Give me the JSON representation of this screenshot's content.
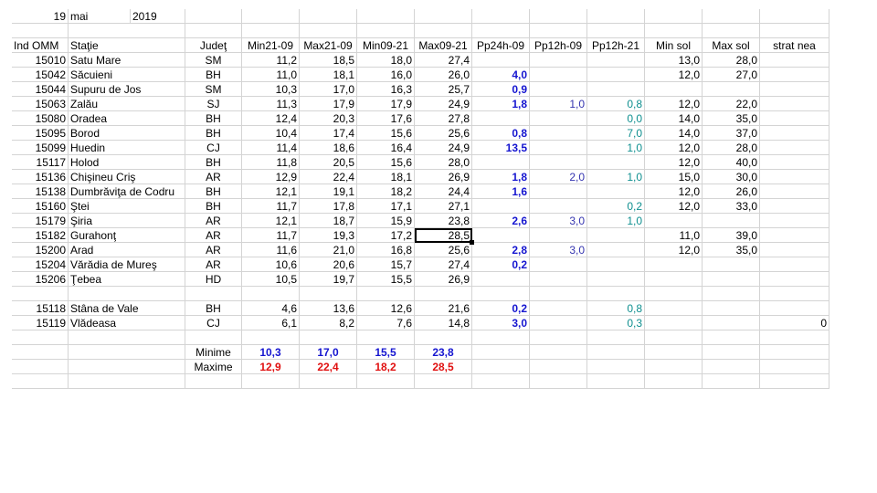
{
  "date": {
    "day": "19",
    "month": "mai",
    "year": "2019"
  },
  "headers": [
    "Ind OMM",
    "Staţie",
    "Judeţ",
    "Min21-09",
    "Max21-09",
    "Min09-21",
    "Max09-21",
    "Pp24h-09",
    "Pp12h-09",
    "Pp12h-21",
    "Min sol",
    "Max sol",
    "strat nea"
  ],
  "rows": [
    [
      "15010",
      "Satu Mare",
      "SM",
      "11,2",
      "18,5",
      "18,0",
      "27,4",
      "",
      "",
      "",
      "13,0",
      "28,0",
      ""
    ],
    [
      "15042",
      "Săcuieni",
      "BH",
      "11,0",
      "18,1",
      "16,0",
      "26,0",
      "4,0",
      "",
      "",
      "12,0",
      "27,0",
      ""
    ],
    [
      "15044",
      "Supuru de Jos",
      "SM",
      "10,3",
      "17,0",
      "16,3",
      "25,7",
      "0,9",
      "",
      "",
      "",
      "",
      ""
    ],
    [
      "15063",
      "Zalău",
      "SJ",
      "11,3",
      "17,9",
      "17,9",
      "24,9",
      "1,8",
      "1,0",
      "0,8",
      "12,0",
      "22,0",
      ""
    ],
    [
      "15080",
      "Oradea",
      "BH",
      "12,4",
      "20,3",
      "17,6",
      "27,8",
      "",
      "",
      "0,0",
      "14,0",
      "35,0",
      ""
    ],
    [
      "15095",
      "Borod",
      "BH",
      "10,4",
      "17,4",
      "15,6",
      "25,6",
      "0,8",
      "",
      "7,0",
      "14,0",
      "37,0",
      ""
    ],
    [
      "15099",
      "Huedin",
      "CJ",
      "11,4",
      "18,6",
      "16,4",
      "24,9",
      "13,5",
      "",
      "1,0",
      "12,0",
      "28,0",
      ""
    ],
    [
      "15117",
      "Holod",
      "BH",
      "11,8",
      "20,5",
      "15,6",
      "28,0",
      "",
      "",
      "",
      "12,0",
      "40,0",
      ""
    ],
    [
      "15136",
      "Chişineu    Criş",
      "AR",
      "12,9",
      "22,4",
      "18,1",
      "26,9",
      "1,8",
      "2,0",
      "1,0",
      "15,0",
      "30,0",
      ""
    ],
    [
      "15138",
      "Dumbrăviţa  de Codru",
      "BH",
      "12,1",
      "19,1",
      "18,2",
      "24,4",
      "1,6",
      "",
      "",
      "12,0",
      "26,0",
      ""
    ],
    [
      "15160",
      "Ştei",
      "BH",
      "11,7",
      "17,8",
      "17,1",
      "27,1",
      "",
      "",
      "0,2",
      "12,0",
      "33,0",
      ""
    ],
    [
      "15179",
      "Şiria",
      "AR",
      "12,1",
      "18,7",
      "15,9",
      "23,8",
      "2,6",
      "3,0",
      "1,0",
      "",
      "",
      ""
    ],
    [
      "15182",
      "Gurahonţ",
      "AR",
      "11,7",
      "19,3",
      "17,2",
      "28,5",
      "",
      "",
      "",
      "11,0",
      "39,0",
      ""
    ],
    [
      "15200",
      "Arad",
      "AR",
      "11,6",
      "21,0",
      "16,8",
      "25,6",
      "2,8",
      "3,0",
      "",
      "12,0",
      "35,0",
      ""
    ],
    [
      "15204",
      "Vărădia de Mureş",
      "AR",
      "10,6",
      "20,6",
      "15,7",
      "27,4",
      "0,2",
      "",
      "",
      "",
      "",
      ""
    ],
    [
      "15206",
      "Ţebea",
      "HD",
      "10,5",
      "19,7",
      "15,5",
      "26,9",
      "",
      "",
      "",
      "",
      "",
      ""
    ],
    [
      "",
      "",
      "",
      "",
      "",
      "",
      "",
      "",
      "",
      "",
      "",
      "",
      ""
    ],
    [
      "15118",
      "Stâna de Vale",
      "BH",
      "4,6",
      "13,6",
      "12,6",
      "21,6",
      "0,2",
      "",
      "0,8",
      "",
      "",
      ""
    ],
    [
      "15119",
      "Vlădeasa",
      "CJ",
      "6,1",
      "8,2",
      "7,6",
      "14,8",
      "3,0",
      "",
      "0,3",
      "",
      "",
      "0"
    ]
  ],
  "summary": [
    {
      "label": "Minime",
      "values": [
        "10,3",
        "17,0",
        "15,5",
        "23,8"
      ],
      "color": "#1515d0"
    },
    {
      "label": "Maxime",
      "values": [
        "12,9",
        "22,4",
        "18,2",
        "28,5"
      ],
      "color": "#e01010"
    }
  ],
  "selected_cell": {
    "row": 12,
    "col": 6
  }
}
